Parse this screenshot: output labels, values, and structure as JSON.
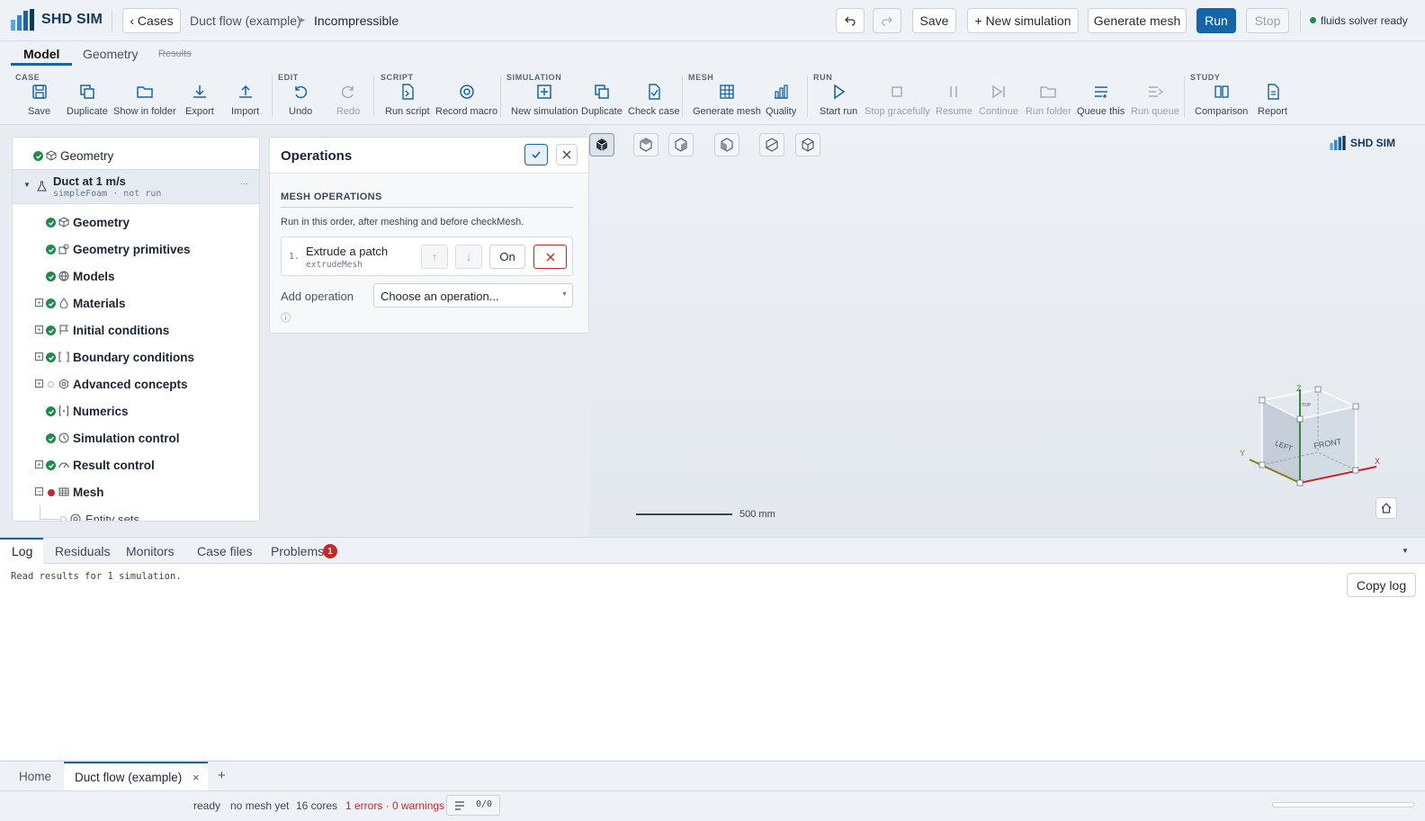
{
  "app": {
    "name": "SHD SIM",
    "status": "fluids solver ready",
    "status_color": "#1e8a4c",
    "accent": "#1565a8"
  },
  "header": {
    "cases_label": "‹ Cases",
    "breadcrumb": [
      "Duct flow (example)",
      "Incompressible"
    ],
    "undo_icon": "undo-icon",
    "redo_icon": "redo-icon",
    "save_label": "Save",
    "new_sim_label": "+ New simulation",
    "gen_mesh_label": "Generate mesh",
    "run_label": "Run",
    "stop_label": "Stop"
  },
  "main_tabs": [
    {
      "label": "Model",
      "active": true
    },
    {
      "label": "Geometry",
      "active": false
    },
    {
      "label": "Results",
      "active": false
    }
  ],
  "ribbon": {
    "groups": {
      "case": "CASE",
      "edit": "EDIT",
      "script": "SCRIPT",
      "simulation": "SIMULATION",
      "mesh": "MESH",
      "run": "RUN",
      "study": "STUDY"
    },
    "items": [
      {
        "label": "Save",
        "icon": "save-icon"
      },
      {
        "label": "Duplicate",
        "icon": "duplicate-icon"
      },
      {
        "label": "Show in folder",
        "icon": "folder-icon"
      },
      {
        "label": "Export",
        "icon": "export-icon"
      },
      {
        "label": "Import",
        "icon": "import-icon"
      },
      {
        "label": "Undo",
        "icon": "undo-icon"
      },
      {
        "label": "Redo",
        "icon": "redo-icon"
      },
      {
        "label": "Run script",
        "icon": "script-icon"
      },
      {
        "label": "Record macro",
        "icon": "record-icon"
      },
      {
        "label": "New simulation",
        "icon": "plus-square-icon"
      },
      {
        "label": "Duplicate",
        "icon": "duplicate-icon"
      },
      {
        "label": "Check case",
        "icon": "check-case-icon"
      },
      {
        "label": "Generate mesh",
        "icon": "grid-icon"
      },
      {
        "label": "Quality",
        "icon": "bar-chart-icon"
      },
      {
        "label": "Start run",
        "icon": "play-icon"
      },
      {
        "label": "Stop gracefully",
        "icon": "stop-icon"
      },
      {
        "label": "Resume",
        "icon": "pause-icon"
      },
      {
        "label": "Continue",
        "icon": "continue-icon"
      },
      {
        "label": "Run folder",
        "icon": "folder-icon"
      },
      {
        "label": "Queue this",
        "icon": "queue-icon"
      },
      {
        "label": "Run queue",
        "icon": "run-queue-icon"
      },
      {
        "label": "Comparison",
        "icon": "comparison-icon"
      },
      {
        "label": "Report",
        "icon": "report-icon"
      }
    ]
  },
  "tree": {
    "top": "Geometry",
    "sim_name": "Duct at 1 m/s",
    "sim_sub": "simpleFoam · not run",
    "sim_more": "···",
    "items": [
      {
        "label": "Geometry"
      },
      {
        "label": "Geometry primitives"
      },
      {
        "label": "Models"
      },
      {
        "label": "Materials"
      },
      {
        "label": "Initial conditions"
      },
      {
        "label": "Boundary conditions"
      },
      {
        "label": "Advanced concepts"
      },
      {
        "label": "Numerics"
      },
      {
        "label": "Simulation control"
      },
      {
        "label": "Result control"
      },
      {
        "label": "Mesh"
      },
      {
        "label": "Entity sets"
      }
    ]
  },
  "operations": {
    "title": "Operations",
    "section": "MESH OPERATIONS",
    "hint": "Run in this order, after meshing and before checkMesh.",
    "op_index": "1.",
    "op_name": "Extrude a patch",
    "op_code": "extrudeMesh",
    "up": "↑",
    "down": "↓",
    "toggle": "On",
    "add_label": "Add operation",
    "add_placeholder": "Choose an operation...",
    "info": "ⓘ"
  },
  "viewport": {
    "scale_label": "500 mm",
    "brand": "SHD SIM",
    "axes": {
      "x": "X",
      "y": "Y",
      "z": "Z"
    },
    "faces": {
      "left": "LEFT",
      "front": "FRONT",
      "top": "TOP"
    }
  },
  "bottom_tabs": {
    "log": "Log",
    "residuals": "Residuals",
    "monitors": "Monitors",
    "case_files": "Case files",
    "problems": "Problems",
    "problems_count": "1"
  },
  "log": {
    "text": "Read results for 1 simulation.",
    "copy": "Copy log"
  },
  "file_tabs": {
    "home": "Home",
    "active": "Duct flow (example)",
    "close": "×",
    "add": "+"
  },
  "status": {
    "ready": "ready",
    "mesh": "no mesh yet",
    "cores": "16 cores",
    "problems": "1 errors · 0 warnings",
    "counter": "0/0",
    "error_color": "#c62828"
  }
}
